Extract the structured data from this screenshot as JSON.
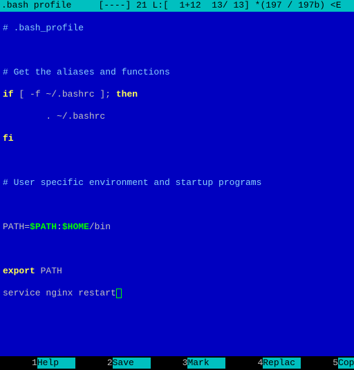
{
  "topbar": {
    "filename": ".bash profile",
    "status": "[----] 21 L:[  1+12  13/ 13] *(197 / 197b) <E"
  },
  "code": {
    "l1": "# .bash_profile",
    "l3": "# Get the aliases and functions",
    "l4_if": "if",
    "l4_cond": " [ -f ~/.bashrc ]; ",
    "l4_then": "then",
    "l5": "        . ~/.bashrc",
    "l6_fi": "fi",
    "l8": "# User specific environment and startup programs",
    "l10_path": "PATH=",
    "l10_var1": "$PATH",
    "l10_colon": ":",
    "l10_var2": "$HOME",
    "l10_bin": "/bin",
    "l12_export": "export",
    "l12_rest": " PATH",
    "l13": "service nginx restart"
  },
  "fkeys": {
    "k1n": "1",
    "k1l": "Help",
    "k2n": "2",
    "k2l": "Save",
    "k3n": "3",
    "k3l": "Mark",
    "k4n": "4",
    "k4l": "Replac",
    "k5n": "5",
    "k5l": "Copy"
  }
}
